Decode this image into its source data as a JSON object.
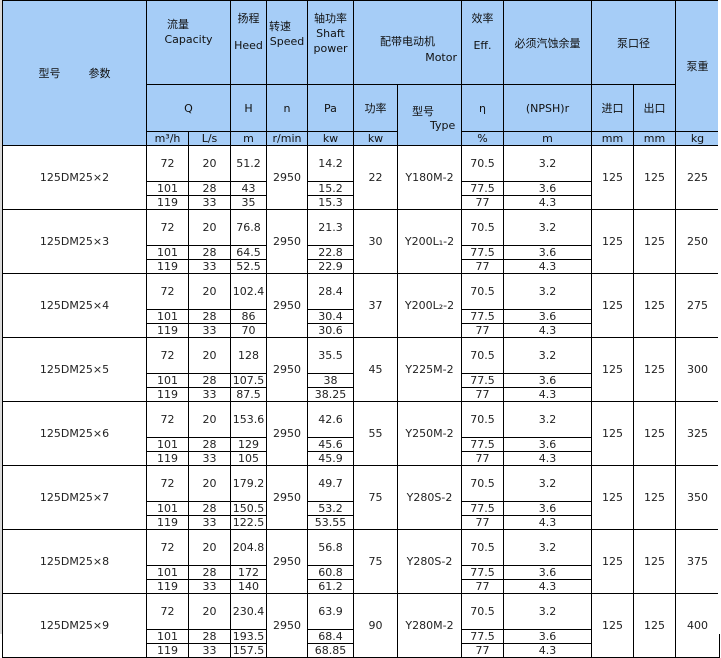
{
  "header": {
    "model_param": [
      "型号",
      "参数"
    ],
    "capacity": {
      "cn": "流量",
      "en": "Capacity",
      "symbol": "Q",
      "units": [
        "m³/h",
        "L/s"
      ]
    },
    "head": {
      "cn": "扬程",
      "en": "Heed",
      "symbol": "H",
      "unit": "m"
    },
    "speed": {
      "cn": "转速",
      "en": "Speed",
      "symbol": "n",
      "unit": "r/min"
    },
    "shaft_power": {
      "cn": "轴功率",
      "en1": "Shaft",
      "en2": "power",
      "symbol": "Pa",
      "unit": "kw"
    },
    "motor": {
      "cn": "配带电动机",
      "en": "Motor",
      "power_label": "功率",
      "power_unit": "kw",
      "type_cn": "型号",
      "type_en": "Type"
    },
    "efficiency": {
      "cn": "效率",
      "en": "Eff.",
      "symbol": "η",
      "unit": "%"
    },
    "npsh": {
      "cn": "必须汽蚀余量",
      "symbol": "(NPSH)r",
      "unit": "m"
    },
    "port": {
      "cn": "泵口径",
      "inlet": "进口",
      "outlet": "出口",
      "unit": "mm"
    },
    "weight": {
      "cn": "泵重",
      "unit": "kg"
    }
  },
  "rows": [
    {
      "model": "125DM25×2",
      "speed": "2950",
      "motor_kw": "22",
      "motor_type": "Y180M-2",
      "inlet": "125",
      "outlet": "125",
      "weight": "225",
      "points": [
        {
          "q": "72",
          "ls": "20",
          "h": "51.2",
          "pa": "14.2",
          "eff": "70.5",
          "npsh": "3.2"
        },
        {
          "q": "101",
          "ls": "28",
          "h": "43",
          "pa": "15.2",
          "eff": "77.5",
          "npsh": "3.6"
        },
        {
          "q": "119",
          "ls": "33",
          "h": "35",
          "pa": "15.3",
          "eff": "77",
          "npsh": "4.3"
        }
      ]
    },
    {
      "model": "125DM25×3",
      "speed": "2950",
      "motor_kw": "30",
      "motor_type": "Y200L₁-2",
      "inlet": "125",
      "outlet": "125",
      "weight": "250",
      "points": [
        {
          "q": "72",
          "ls": "20",
          "h": "76.8",
          "pa": "21.3",
          "eff": "70.5",
          "npsh": "3.2"
        },
        {
          "q": "101",
          "ls": "28",
          "h": "64.5",
          "pa": "22.8",
          "eff": "77.5",
          "npsh": "3.6"
        },
        {
          "q": "119",
          "ls": "33",
          "h": "52.5",
          "pa": "22.9",
          "eff": "77",
          "npsh": "4.3"
        }
      ]
    },
    {
      "model": "125DM25×4",
      "speed": "2950",
      "motor_kw": "37",
      "motor_type": "Y200L₂-2",
      "inlet": "125",
      "outlet": "125",
      "weight": "275",
      "points": [
        {
          "q": "72",
          "ls": "20",
          "h": "102.4",
          "pa": "28.4",
          "eff": "70.5",
          "npsh": "3.2"
        },
        {
          "q": "101",
          "ls": "28",
          "h": "86",
          "pa": "30.4",
          "eff": "77.5",
          "npsh": "3.6"
        },
        {
          "q": "119",
          "ls": "33",
          "h": "70",
          "pa": "30.6",
          "eff": "77",
          "npsh": "4.3"
        }
      ]
    },
    {
      "model": "125DM25×5",
      "speed": "2950",
      "motor_kw": "45",
      "motor_type": "Y225M-2",
      "inlet": "125",
      "outlet": "125",
      "weight": "300",
      "points": [
        {
          "q": "72",
          "ls": "20",
          "h": "128",
          "pa": "35.5",
          "eff": "70.5",
          "npsh": "3.2"
        },
        {
          "q": "101",
          "ls": "28",
          "h": "107.5",
          "pa": "38",
          "eff": "77.5",
          "npsh": "3.6"
        },
        {
          "q": "119",
          "ls": "33",
          "h": "87.5",
          "pa": "38.25",
          "eff": "77",
          "npsh": "4.3"
        }
      ]
    },
    {
      "model": "125DM25×6",
      "speed": "2950",
      "motor_kw": "55",
      "motor_type": "Y250M-2",
      "inlet": "125",
      "outlet": "125",
      "weight": "325",
      "points": [
        {
          "q": "72",
          "ls": "20",
          "h": "153.6",
          "pa": "42.6",
          "eff": "70.5",
          "npsh": "3.2"
        },
        {
          "q": "101",
          "ls": "28",
          "h": "129",
          "pa": "45.6",
          "eff": "77.5",
          "npsh": "3.6"
        },
        {
          "q": "119",
          "ls": "33",
          "h": "105",
          "pa": "45.9",
          "eff": "77",
          "npsh": "4.3"
        }
      ]
    },
    {
      "model": "125DM25×7",
      "speed": "2950",
      "motor_kw": "75",
      "motor_type": "Y280S-2",
      "inlet": "125",
      "outlet": "125",
      "weight": "350",
      "points": [
        {
          "q": "72",
          "ls": "20",
          "h": "179.2",
          "pa": "49.7",
          "eff": "70.5",
          "npsh": "3.2"
        },
        {
          "q": "101",
          "ls": "28",
          "h": "150.5",
          "pa": "53.2",
          "eff": "77.5",
          "npsh": "3.6"
        },
        {
          "q": "119",
          "ls": "33",
          "h": "122.5",
          "pa": "53.55",
          "eff": "77",
          "npsh": "4.3"
        }
      ]
    },
    {
      "model": "125DM25×8",
      "speed": "2950",
      "motor_kw": "75",
      "motor_type": "Y280S-2",
      "inlet": "125",
      "outlet": "125",
      "weight": "375",
      "points": [
        {
          "q": "72",
          "ls": "20",
          "h": "204.8",
          "pa": "56.8",
          "eff": "70.5",
          "npsh": "3.2"
        },
        {
          "q": "101",
          "ls": "28",
          "h": "172",
          "pa": "60.8",
          "eff": "77.5",
          "npsh": "3.6"
        },
        {
          "q": "119",
          "ls": "33",
          "h": "140",
          "pa": "61.2",
          "eff": "77",
          "npsh": "4.3"
        }
      ]
    },
    {
      "model": "125DM25×9",
      "speed": "2950",
      "motor_kw": "90",
      "motor_type": "Y280M-2",
      "inlet": "125",
      "outlet": "125",
      "weight": "400",
      "points": [
        {
          "q": "72",
          "ls": "20",
          "h": "230.4",
          "pa": "63.9",
          "eff": "70.5",
          "npsh": "3.2"
        },
        {
          "q": "101",
          "ls": "28",
          "h": "193.5",
          "pa": "68.4",
          "eff": "77.5",
          "npsh": "3.6"
        },
        {
          "q": "119",
          "ls": "33",
          "h": "157.5",
          "pa": "68.85",
          "eff": "77",
          "npsh": "4.3"
        }
      ]
    }
  ]
}
